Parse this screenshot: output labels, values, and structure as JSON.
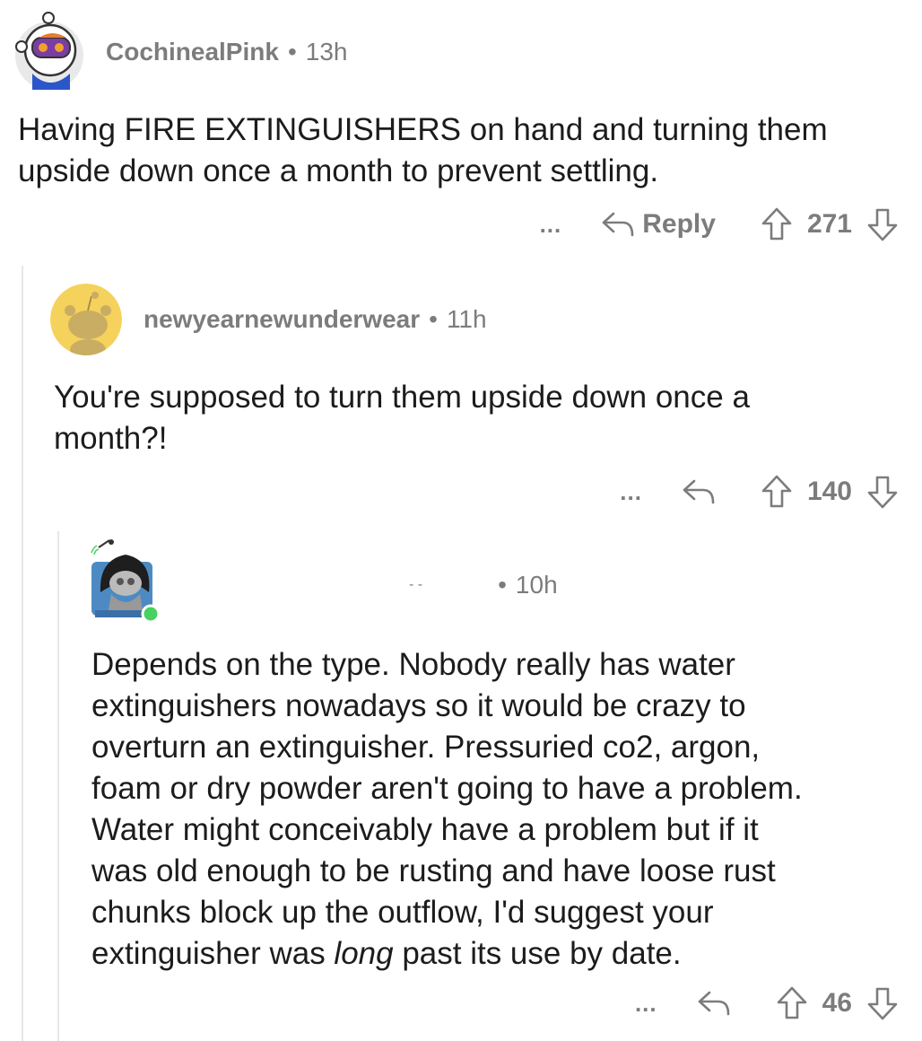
{
  "comments": [
    {
      "username": "CochinealPink",
      "separator": "•",
      "time": "13h",
      "text_lines": [
        "Having FIRE EXTINGUISHERS on hand and turning them",
        "upside down once a month to prevent settling."
      ],
      "more": "...",
      "reply_label": "Reply",
      "score": "271",
      "avatar_icon": "astronaut-snoo-avatar"
    },
    {
      "username": "newyearnewunderwear",
      "separator": "•",
      "time": "11h",
      "text_lines": [
        "You're supposed to turn them upside down once a",
        "month?!"
      ],
      "more": "...",
      "score": "140",
      "avatar_icon": "default-snoo-avatar"
    },
    {
      "username": "",
      "separator": "•",
      "time": "10h",
      "username_mark": "- -",
      "text_lines": [
        "Depends on the type. Nobody really has water",
        "extinguishers nowadays so it would be crazy to",
        "overturn an extinguisher. Pressuried co2, argon,",
        "foam or dry powder aren't going to have a problem.",
        "Water might conceivably have a problem but if it",
        "was old enough to be rusting and have loose rust",
        "chunks block up the outflow, I'd suggest your"
      ],
      "last_line_before": "extinguisher was ",
      "last_line_em": "long",
      "last_line_after": " past its use by date.",
      "more": "...",
      "score": "46",
      "avatar_icon": "hooded-snoo-avatar"
    }
  ],
  "colors": {
    "text": "#1c1c1c",
    "meta": "#7c7c7c",
    "thread_line": "#e6e6e6",
    "online": "#46d160"
  }
}
